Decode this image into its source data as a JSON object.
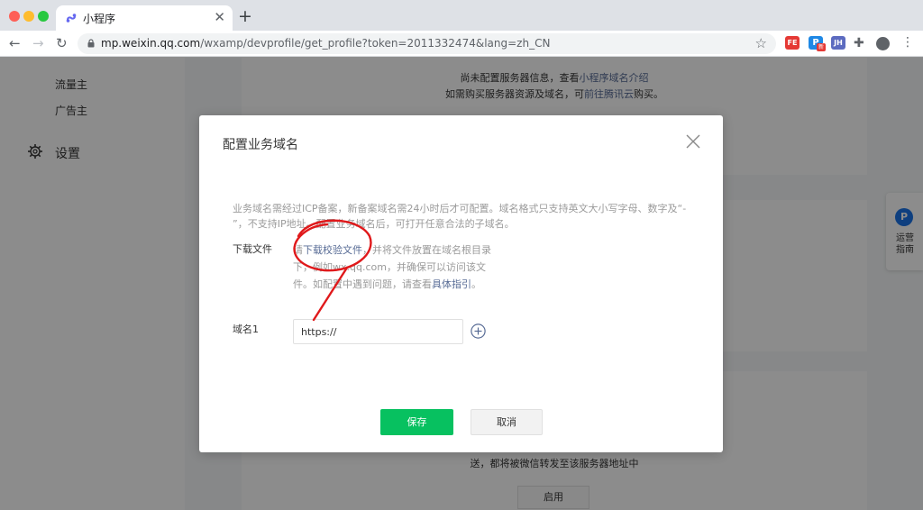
{
  "browser": {
    "tab_title": "小程序",
    "tab_close": "✕",
    "new_tab": "+",
    "url_host": "mp.weixin.qq.com",
    "url_path": "/wxamp/devprofile/get_profile?token=2011332474&lang=zh_CN",
    "ext_fe": "FE",
    "ext_p": "P",
    "ext_p_badge": "新",
    "ext_jh": "JH"
  },
  "sidebar": {
    "items": [
      {
        "label": "流量主"
      },
      {
        "label": "广告主"
      }
    ],
    "settings_label": "设置"
  },
  "background": {
    "notice_line1_prefix": "尚未配置服务器信息，查看",
    "notice_line1_link": "小程序域名介绍",
    "notice_line2_prefix": "如需购买服务器资源及域名，可",
    "notice_line2_link": "前往腾讯云",
    "notice_line2_suffix": "购买。",
    "bottom_text": "送，都将被微信转发至该服务器地址中",
    "enable_button": "启用"
  },
  "float_guide": {
    "icon_letter": "P",
    "label_line1": "运营",
    "label_line2": "指南"
  },
  "dialog": {
    "title": "配置业务域名",
    "hint": "业务域名需经过ICP备案，新备案域名需24小时后才可配置。域名格式只支持英文大小写字母、数字及“- ”，不支持IP地址。配置业务域名后，可打开任意合法的子域名。",
    "download_label": "下载文件",
    "download_prefix": "请",
    "download_link": "下载校验文件",
    "download_middle": "，并将文件放置在域名根目录下，例如wx.qq.com，并确保可以访问该文件。如配置中遇到问题，请查看",
    "download_guide_link": "具体指引",
    "download_suffix": "。",
    "domain_label": "域名1",
    "domain_value": "https://",
    "save_button": "保存",
    "cancel_button": "取消"
  },
  "colors": {
    "primary_green": "#07c160",
    "link_blue": "#576b95",
    "annotation_red": "#e0191b"
  }
}
